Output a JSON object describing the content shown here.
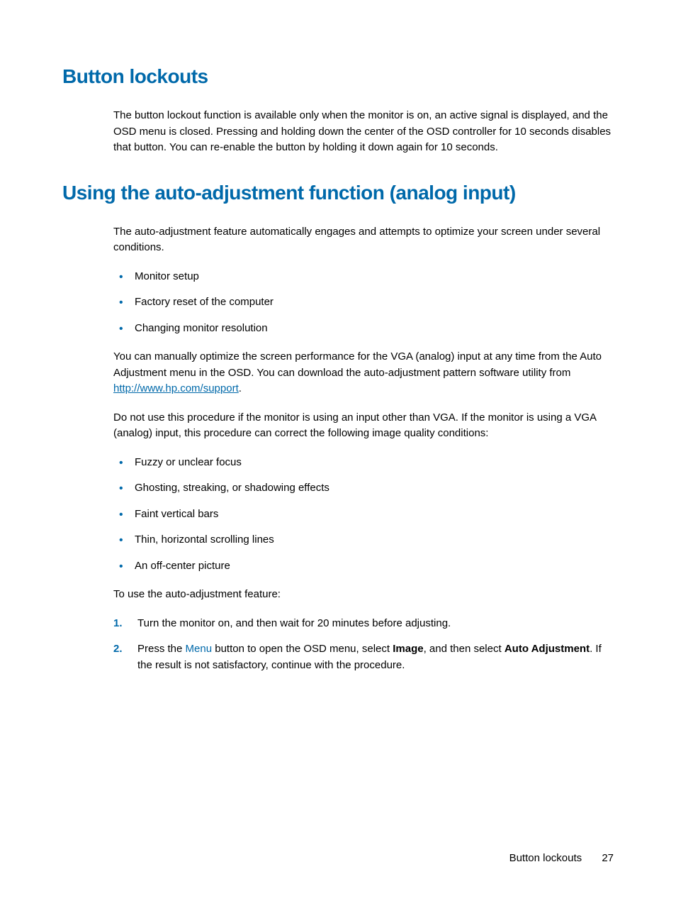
{
  "section1": {
    "heading": "Button lockouts",
    "para1": "The button lockout function is available only when the monitor is on, an active signal is displayed, and the OSD menu is closed. Pressing and holding down the center of the OSD controller for 10 seconds disables that button. You can re-enable the button by holding it down again for 10 seconds."
  },
  "section2": {
    "heading": "Using the auto-adjustment function (analog input)",
    "intro": "The auto-adjustment feature automatically engages and attempts to optimize your screen under several conditions.",
    "conditions": [
      "Monitor setup",
      "Factory reset of the computer",
      "Changing monitor resolution"
    ],
    "para2a": "You can manually optimize the screen performance for the VGA (analog) input at any time from the Auto Adjustment menu in the OSD. You can download the auto-adjustment pattern software utility from ",
    "link_text": "http://www.hp.com/support",
    "para2b": ".",
    "para3": "Do not use this procedure if the monitor is using an input other than VGA. If the monitor is using a VGA (analog) input, this procedure can correct the following image quality conditions:",
    "quality_conditions": [
      "Fuzzy or unclear focus",
      "Ghosting, streaking, or shadowing effects",
      "Faint vertical bars",
      "Thin, horizontal scrolling lines",
      "An off-center picture"
    ],
    "para4": "To use the auto-adjustment feature:",
    "steps": {
      "s1": "Turn the monitor on, and then wait for 20 minutes before adjusting.",
      "s2_a": "Press the ",
      "s2_menu": "Menu",
      "s2_b": " button to open the OSD menu, select ",
      "s2_image": "Image",
      "s2_c": ", and then select ",
      "s2_auto": "Auto Adjustment",
      "s2_d": ". If the result is not satisfactory, continue with the procedure."
    }
  },
  "footer": {
    "title": "Button lockouts",
    "page": "27"
  }
}
